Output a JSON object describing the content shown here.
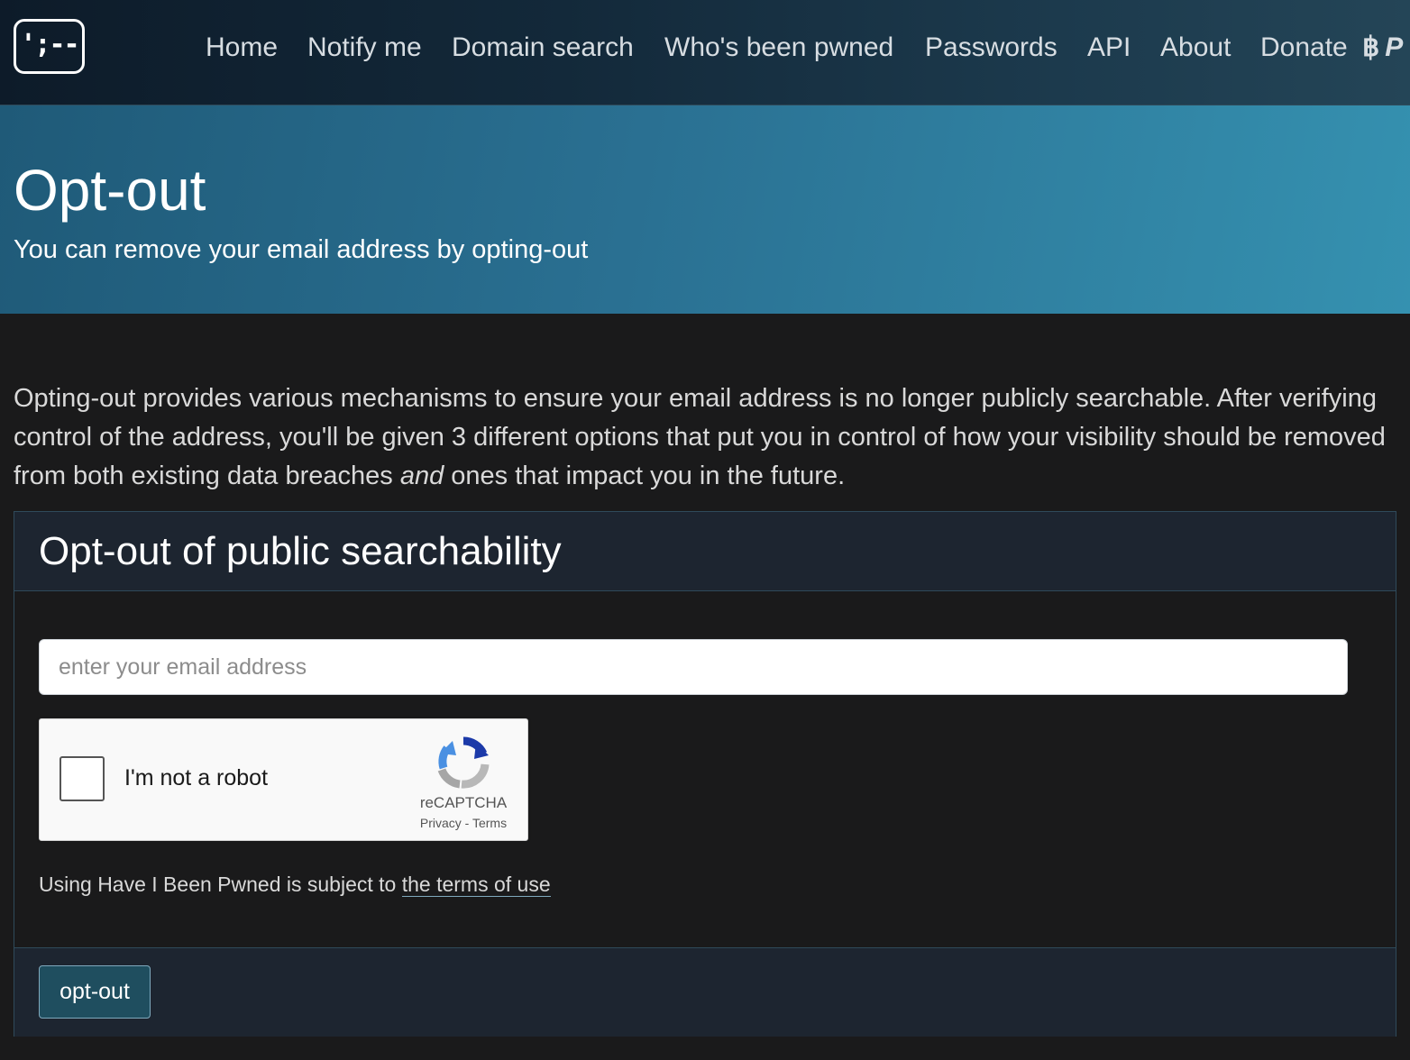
{
  "nav": {
    "logo_text": "';--",
    "links": [
      "Home",
      "Notify me",
      "Domain search",
      "Who's been pwned",
      "Passwords",
      "API",
      "About",
      "Donate"
    ],
    "donate_icons": [
      "bitcoin-icon",
      "paypal-icon"
    ]
  },
  "hero": {
    "title": "Opt-out",
    "subtitle": "You can remove your email address by opting-out"
  },
  "intro": {
    "text_before": "Opting-out provides various mechanisms to ensure your email address is no longer publicly searchable. After verifying control of the address, you'll be given 3 different options that put you in control of how your visibility should be removed from both existing data breaches ",
    "emphasis": "and",
    "text_after": " ones that impact you in the future."
  },
  "form": {
    "heading": "Opt-out of public searchability",
    "email_placeholder": "enter your email address",
    "recaptcha": {
      "label": "I'm not a robot",
      "brand": "reCAPTCHA",
      "privacy": "Privacy",
      "separator": "-",
      "terms": "Terms"
    },
    "terms_prefix": "Using Have I Been Pwned is subject to ",
    "terms_link": "the terms of use",
    "submit_label": "opt-out"
  },
  "colors": {
    "navbar_bg": "#13293a",
    "hero_bg": "#2a7092",
    "page_bg": "#1a1a1b",
    "card_header_bg": "#1d2530",
    "button_bg": "#1f4e5f"
  }
}
